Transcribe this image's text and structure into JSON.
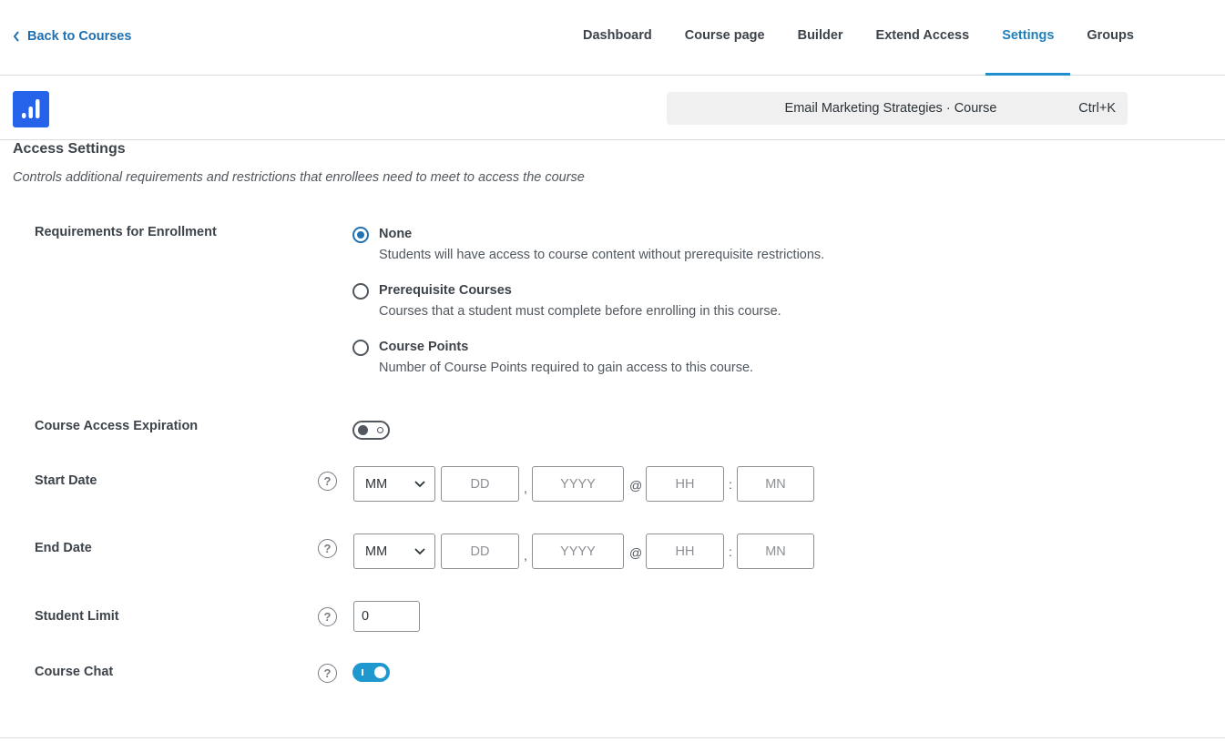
{
  "nav": {
    "back_label": "Back to Courses",
    "tabs": [
      {
        "label": "Dashboard"
      },
      {
        "label": "Course page"
      },
      {
        "label": "Builder"
      },
      {
        "label": "Extend Access"
      },
      {
        "label": "Settings"
      },
      {
        "label": "Groups"
      }
    ],
    "active_tab": "Settings"
  },
  "subbar": {
    "search_text": "Email Marketing Strategies · Course",
    "shortcut": "Ctrl+K",
    "brand_color": "#2563eb"
  },
  "section": {
    "title": "Access Settings",
    "description": "Controls additional requirements and restrictions that enrollees need to meet to access the course"
  },
  "enrollment": {
    "label": "Requirements for Enrollment",
    "options": [
      {
        "title": "None",
        "description": "Students will have access to course content without prerequisite restrictions.",
        "checked": true
      },
      {
        "title": "Prerequisite Courses",
        "description": "Courses that a student must complete before enrolling in this course.",
        "checked": false
      },
      {
        "title": "Course Points",
        "description": "Number of Course Points required to gain access to this course.",
        "checked": false
      }
    ]
  },
  "expiration": {
    "label": "Course Access Expiration",
    "enabled": false
  },
  "start_date": {
    "label": "Start Date",
    "month": "MM",
    "day_placeholder": "DD",
    "year_placeholder": "YYYY",
    "hour_placeholder": "HH",
    "minute_placeholder": "MN"
  },
  "end_date": {
    "label": "End Date",
    "month": "MM",
    "day_placeholder": "DD",
    "year_placeholder": "YYYY",
    "hour_placeholder": "HH",
    "minute_placeholder": "MN"
  },
  "separators": {
    "comma": ",",
    "at": "@",
    "colon": ":"
  },
  "student_limit": {
    "label": "Student Limit",
    "value": "0"
  },
  "course_chat": {
    "label": "Course Chat",
    "enabled": true
  },
  "help_glyph": "?",
  "colors": {
    "accent": "#1f7fbb",
    "toggle_on": "#1f98cf",
    "radio_checked": "#2271b1"
  }
}
